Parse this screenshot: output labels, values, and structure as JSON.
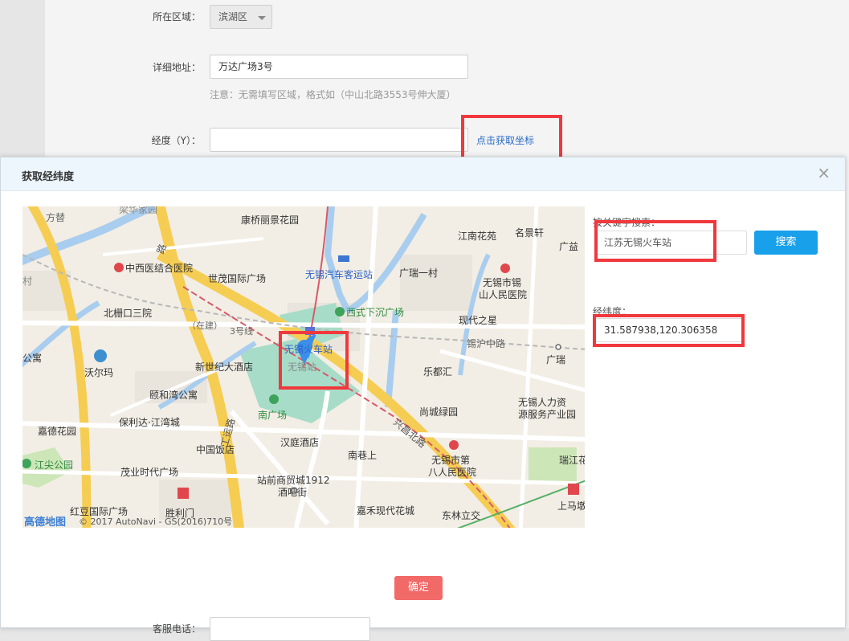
{
  "form": {
    "region_label": "所在区域：",
    "region_value": "滨湖区",
    "address_label": "详细地址：",
    "address_value": "万达广场3号",
    "address_hint": "注意：无需填写区域，格式如（中山北路3553号伸大厦）",
    "longitude_label": "经度（Y）：",
    "longitude_value": "",
    "get_coord_link": "点击获取坐标",
    "bottom_label": "客服电话："
  },
  "dialog": {
    "title": "获取经纬度",
    "close_symbol": "×",
    "search_label": "按关键字搜索：",
    "search_value": "江苏无锡火车站",
    "search_button": "搜索",
    "latlng_label": "经纬度：",
    "latlng_value": "31.587938,120.306358",
    "confirm_button": "确定"
  },
  "map": {
    "labels": {
      "l1": "康桥丽景花园",
      "l2": "江南花苑",
      "l3": "名景轩",
      "l4": "广益",
      "l5": "中西医结合医院",
      "l6": "世茂国际广场",
      "l7": "无锡汽车客运站",
      "l8": "广瑞一村",
      "l9": "无锡市锡",
      "l10": "山人民医院",
      "l11": "北栅口三院",
      "l12": "西式下沉广场",
      "l13": "现代之星",
      "l14": "（在建）",
      "l15": "3号线",
      "l16": "锡沪中路",
      "l17": "公寓",
      "l18": "无锡火车站",
      "l19": "无锡站",
      "l20": "广瑞",
      "l21": "沃尔玛",
      "l22": "新世纪大酒店",
      "l23": "乐都汇",
      "l24": "颐和湾公寓",
      "l25": "无锡人力资",
      "l26": "源服务产业园",
      "l27": "嘉德花园",
      "l28": "保利达·江湾城",
      "l29": "南广场",
      "l30": "尚城绿园",
      "l31": "中国饭店",
      "l32": "汉庭酒店",
      "l33": "南巷上",
      "l34": "无锡市第",
      "l35": "八人民医院",
      "l36": "瑞江花",
      "l37": "江尖公园",
      "l38": "茂业时代广场",
      "l39": "站前商贸城1912",
      "l40": "酒吧街",
      "l41": "红豆国际广场",
      "l42": "胜利门",
      "l43": "嘉禾现代花城",
      "l44": "东林立交",
      "l45": "上马墩",
      "l46": "兴昌北路",
      "l47": "工运路",
      "l48": "方替",
      "l49": "村",
      "l50": "梁华家园",
      "l51": "路"
    },
    "logo_text": "高德地图",
    "copyright": "© 2017 AutoNavi - GS(2016)710号"
  },
  "colors": {
    "highlight": "#f0383d",
    "search_button": "#18a0ea",
    "confirm_button": "#f26a68",
    "link": "#2a6cc4"
  }
}
